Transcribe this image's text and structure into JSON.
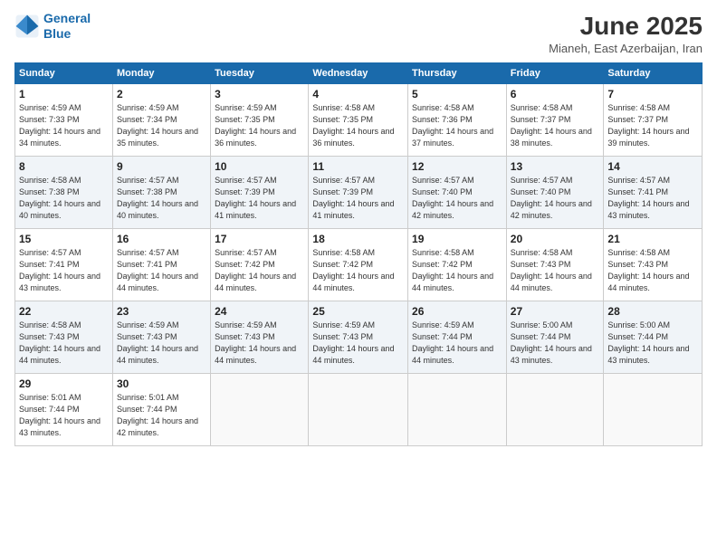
{
  "logo": {
    "line1": "General",
    "line2": "Blue"
  },
  "title": "June 2025",
  "subtitle": "Mianeh, East Azerbaijan, Iran",
  "days_of_week": [
    "Sunday",
    "Monday",
    "Tuesday",
    "Wednesday",
    "Thursday",
    "Friday",
    "Saturday"
  ],
  "weeks": [
    [
      {
        "day": "1",
        "sunrise": "4:59 AM",
        "sunset": "7:33 PM",
        "daylight": "14 hours and 34 minutes."
      },
      {
        "day": "2",
        "sunrise": "4:59 AM",
        "sunset": "7:34 PM",
        "daylight": "14 hours and 35 minutes."
      },
      {
        "day": "3",
        "sunrise": "4:59 AM",
        "sunset": "7:35 PM",
        "daylight": "14 hours and 36 minutes."
      },
      {
        "day": "4",
        "sunrise": "4:58 AM",
        "sunset": "7:35 PM",
        "daylight": "14 hours and 36 minutes."
      },
      {
        "day": "5",
        "sunrise": "4:58 AM",
        "sunset": "7:36 PM",
        "daylight": "14 hours and 37 minutes."
      },
      {
        "day": "6",
        "sunrise": "4:58 AM",
        "sunset": "7:37 PM",
        "daylight": "14 hours and 38 minutes."
      },
      {
        "day": "7",
        "sunrise": "4:58 AM",
        "sunset": "7:37 PM",
        "daylight": "14 hours and 39 minutes."
      }
    ],
    [
      {
        "day": "8",
        "sunrise": "4:58 AM",
        "sunset": "7:38 PM",
        "daylight": "14 hours and 40 minutes."
      },
      {
        "day": "9",
        "sunrise": "4:57 AM",
        "sunset": "7:38 PM",
        "daylight": "14 hours and 40 minutes."
      },
      {
        "day": "10",
        "sunrise": "4:57 AM",
        "sunset": "7:39 PM",
        "daylight": "14 hours and 41 minutes."
      },
      {
        "day": "11",
        "sunrise": "4:57 AM",
        "sunset": "7:39 PM",
        "daylight": "14 hours and 41 minutes."
      },
      {
        "day": "12",
        "sunrise": "4:57 AM",
        "sunset": "7:40 PM",
        "daylight": "14 hours and 42 minutes."
      },
      {
        "day": "13",
        "sunrise": "4:57 AM",
        "sunset": "7:40 PM",
        "daylight": "14 hours and 42 minutes."
      },
      {
        "day": "14",
        "sunrise": "4:57 AM",
        "sunset": "7:41 PM",
        "daylight": "14 hours and 43 minutes."
      }
    ],
    [
      {
        "day": "15",
        "sunrise": "4:57 AM",
        "sunset": "7:41 PM",
        "daylight": "14 hours and 43 minutes."
      },
      {
        "day": "16",
        "sunrise": "4:57 AM",
        "sunset": "7:41 PM",
        "daylight": "14 hours and 44 minutes."
      },
      {
        "day": "17",
        "sunrise": "4:57 AM",
        "sunset": "7:42 PM",
        "daylight": "14 hours and 44 minutes."
      },
      {
        "day": "18",
        "sunrise": "4:58 AM",
        "sunset": "7:42 PM",
        "daylight": "14 hours and 44 minutes."
      },
      {
        "day": "19",
        "sunrise": "4:58 AM",
        "sunset": "7:42 PM",
        "daylight": "14 hours and 44 minutes."
      },
      {
        "day": "20",
        "sunrise": "4:58 AM",
        "sunset": "7:43 PM",
        "daylight": "14 hours and 44 minutes."
      },
      {
        "day": "21",
        "sunrise": "4:58 AM",
        "sunset": "7:43 PM",
        "daylight": "14 hours and 44 minutes."
      }
    ],
    [
      {
        "day": "22",
        "sunrise": "4:58 AM",
        "sunset": "7:43 PM",
        "daylight": "14 hours and 44 minutes."
      },
      {
        "day": "23",
        "sunrise": "4:59 AM",
        "sunset": "7:43 PM",
        "daylight": "14 hours and 44 minutes."
      },
      {
        "day": "24",
        "sunrise": "4:59 AM",
        "sunset": "7:43 PM",
        "daylight": "14 hours and 44 minutes."
      },
      {
        "day": "25",
        "sunrise": "4:59 AM",
        "sunset": "7:43 PM",
        "daylight": "14 hours and 44 minutes."
      },
      {
        "day": "26",
        "sunrise": "4:59 AM",
        "sunset": "7:44 PM",
        "daylight": "14 hours and 44 minutes."
      },
      {
        "day": "27",
        "sunrise": "5:00 AM",
        "sunset": "7:44 PM",
        "daylight": "14 hours and 43 minutes."
      },
      {
        "day": "28",
        "sunrise": "5:00 AM",
        "sunset": "7:44 PM",
        "daylight": "14 hours and 43 minutes."
      }
    ],
    [
      {
        "day": "29",
        "sunrise": "5:01 AM",
        "sunset": "7:44 PM",
        "daylight": "14 hours and 43 minutes."
      },
      {
        "day": "30",
        "sunrise": "5:01 AM",
        "sunset": "7:44 PM",
        "daylight": "14 hours and 42 minutes."
      },
      null,
      null,
      null,
      null,
      null
    ]
  ]
}
